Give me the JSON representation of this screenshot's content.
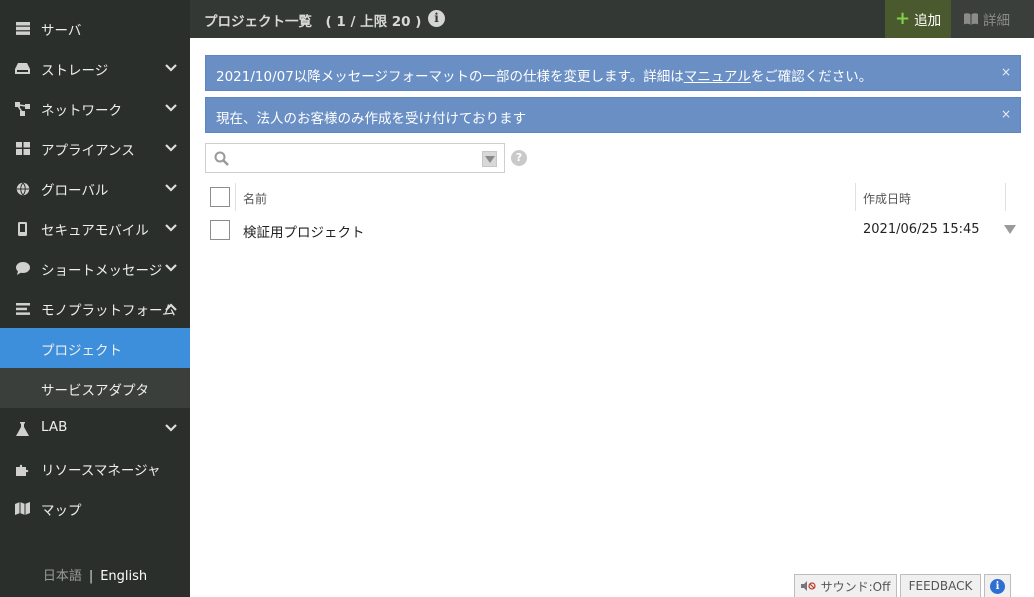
{
  "sidebar": {
    "items": [
      {
        "label": "サーバ",
        "icon": "server-icon",
        "chevron": false
      },
      {
        "label": "ストレージ",
        "icon": "storage-icon",
        "chevron": true
      },
      {
        "label": "ネットワーク",
        "icon": "network-icon",
        "chevron": true
      },
      {
        "label": "アプライアンス",
        "icon": "appliance-icon",
        "chevron": true
      },
      {
        "label": "グローバル",
        "icon": "globe-icon",
        "chevron": true
      },
      {
        "label": "セキュアモバイル",
        "icon": "mobile-icon",
        "chevron": true
      },
      {
        "label": "ショートメッセージ",
        "icon": "chat-icon",
        "chevron": true
      },
      {
        "label": "モノプラットフォーム",
        "icon": "list-icon",
        "chevron": "up"
      },
      {
        "label": "LAB",
        "icon": "flask-icon",
        "chevron": true
      },
      {
        "label": "リソースマネージャ",
        "icon": "puzzle-icon",
        "chevron": false
      },
      {
        "label": "マップ",
        "icon": "map-icon",
        "chevron": false
      }
    ],
    "subitems": [
      {
        "label": "プロジェクト",
        "active": true
      },
      {
        "label": "サービスアダプタ",
        "active": false
      }
    ],
    "lang": {
      "ja": "日本語",
      "sep": "|",
      "en": "English"
    }
  },
  "header": {
    "title": "プロジェクト一覧　( 1 / 上限 20 )",
    "add_label": "追加",
    "detail_label": "詳細"
  },
  "notices": [
    {
      "pre": "2021/10/07以降メッセージフォーマットの一部の仕様を変更します。詳細は",
      "link": "マニュアル",
      "post": "をご確認ください。",
      "close": "×"
    },
    {
      "text": "現在、法人のお客様のみ作成を受け付けております",
      "close": "×"
    }
  ],
  "search": {
    "value": "",
    "placeholder": ""
  },
  "table": {
    "columns": [
      "名前",
      "作成日時"
    ],
    "rows": [
      {
        "name": "検証用プロジェクト",
        "created": "2021/06/25 15:45"
      }
    ]
  },
  "footer": {
    "sound_label": "サウンド:Off",
    "feedback_label": "FEEDBACK",
    "info_label": "i"
  },
  "colors": {
    "sidebar_bg": "#2b2f2c",
    "active_item": "#3d8fdc",
    "notice_bg": "#6a8fc4",
    "add_button_bg": "#4b5a2e"
  }
}
